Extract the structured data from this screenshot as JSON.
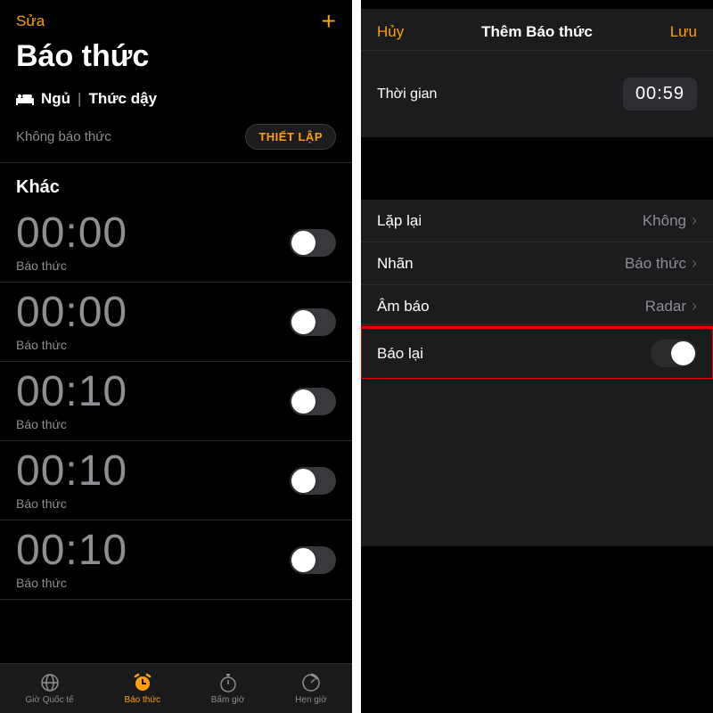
{
  "left": {
    "nav_edit": "Sửa",
    "title": "Báo thức",
    "sleep_label": "Ngủ",
    "wake_label": "Thức dậy",
    "no_alarm": "Không báo thức",
    "setup_btn": "THIẾT LẬP",
    "section_other": "Khác",
    "alarms": [
      {
        "time": "00:00",
        "label": "Báo thức"
      },
      {
        "time": "00:00",
        "label": "Báo thức"
      },
      {
        "time": "00:10",
        "label": "Báo thức"
      },
      {
        "time": "00:10",
        "label": "Báo thức"
      },
      {
        "time": "00:10",
        "label": "Báo thức"
      }
    ],
    "tabs": {
      "world": "Giờ Quốc tế",
      "alarm": "Báo thức",
      "stopwatch": "Bấm giờ",
      "timer": "Hẹn giờ"
    }
  },
  "right": {
    "cancel": "Hủy",
    "title": "Thêm Báo thức",
    "save": "Lưu",
    "time_label": "Thời gian",
    "time_value": "00:59",
    "rows": {
      "repeat_label": "Lặp lại",
      "repeat_value": "Không",
      "name_label": "Nhãn",
      "name_value": "Báo thức",
      "sound_label": "Âm báo",
      "sound_value": "Radar",
      "snooze_label": "Báo lại"
    }
  }
}
